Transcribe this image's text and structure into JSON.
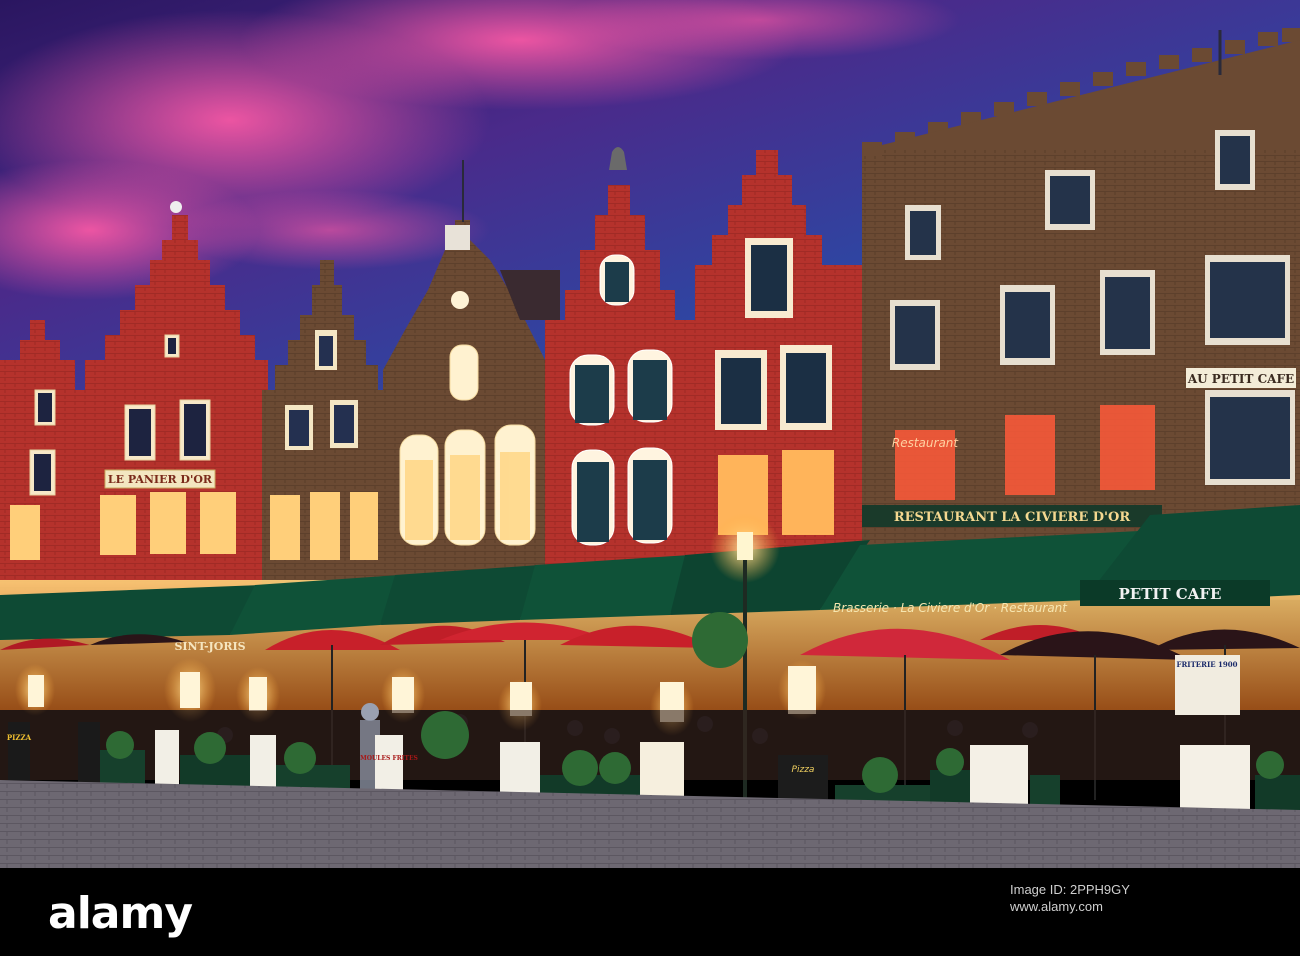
{
  "scene": {
    "description_tags": [
      "market-square",
      "gabled-facades",
      "restaurant-terraces",
      "twilight"
    ],
    "colors": {
      "sky_top": "#3a1a6e",
      "sky_pink": "#d8408f",
      "sky_blue": "#1e3c8c",
      "brick_red": "#b8332e",
      "brick_brown": "#6e4a30",
      "awning_green": "#0f4a35",
      "umbrella_red": "#c8202a",
      "warm_light": "#ffcf6a",
      "cobble": "#6a6570"
    }
  },
  "signs": {
    "panier": "LE PANIER D'OR",
    "restaurant": "RESTAURANT LA CIVIERE D'OR",
    "au_petit_cafe": "AU PETIT CAFE",
    "petit_cafe": "PETIT CAFE",
    "brasserie": "Brasserie · La Civiere d'Or · Restaurant",
    "sint_joris": "SINT-JORIS",
    "friterie": "FRITERIE 1900",
    "neon_restaurant": "Restaurant",
    "pizza": "PIZZA",
    "moules": "MOULES FRITES",
    "menu_pizza": "Pizza"
  },
  "watermark": {
    "logo": "alamy",
    "caption": "Image ID: 2PPH9GY",
    "id": "2PPH9GY",
    "site": "www.alamy.com"
  }
}
